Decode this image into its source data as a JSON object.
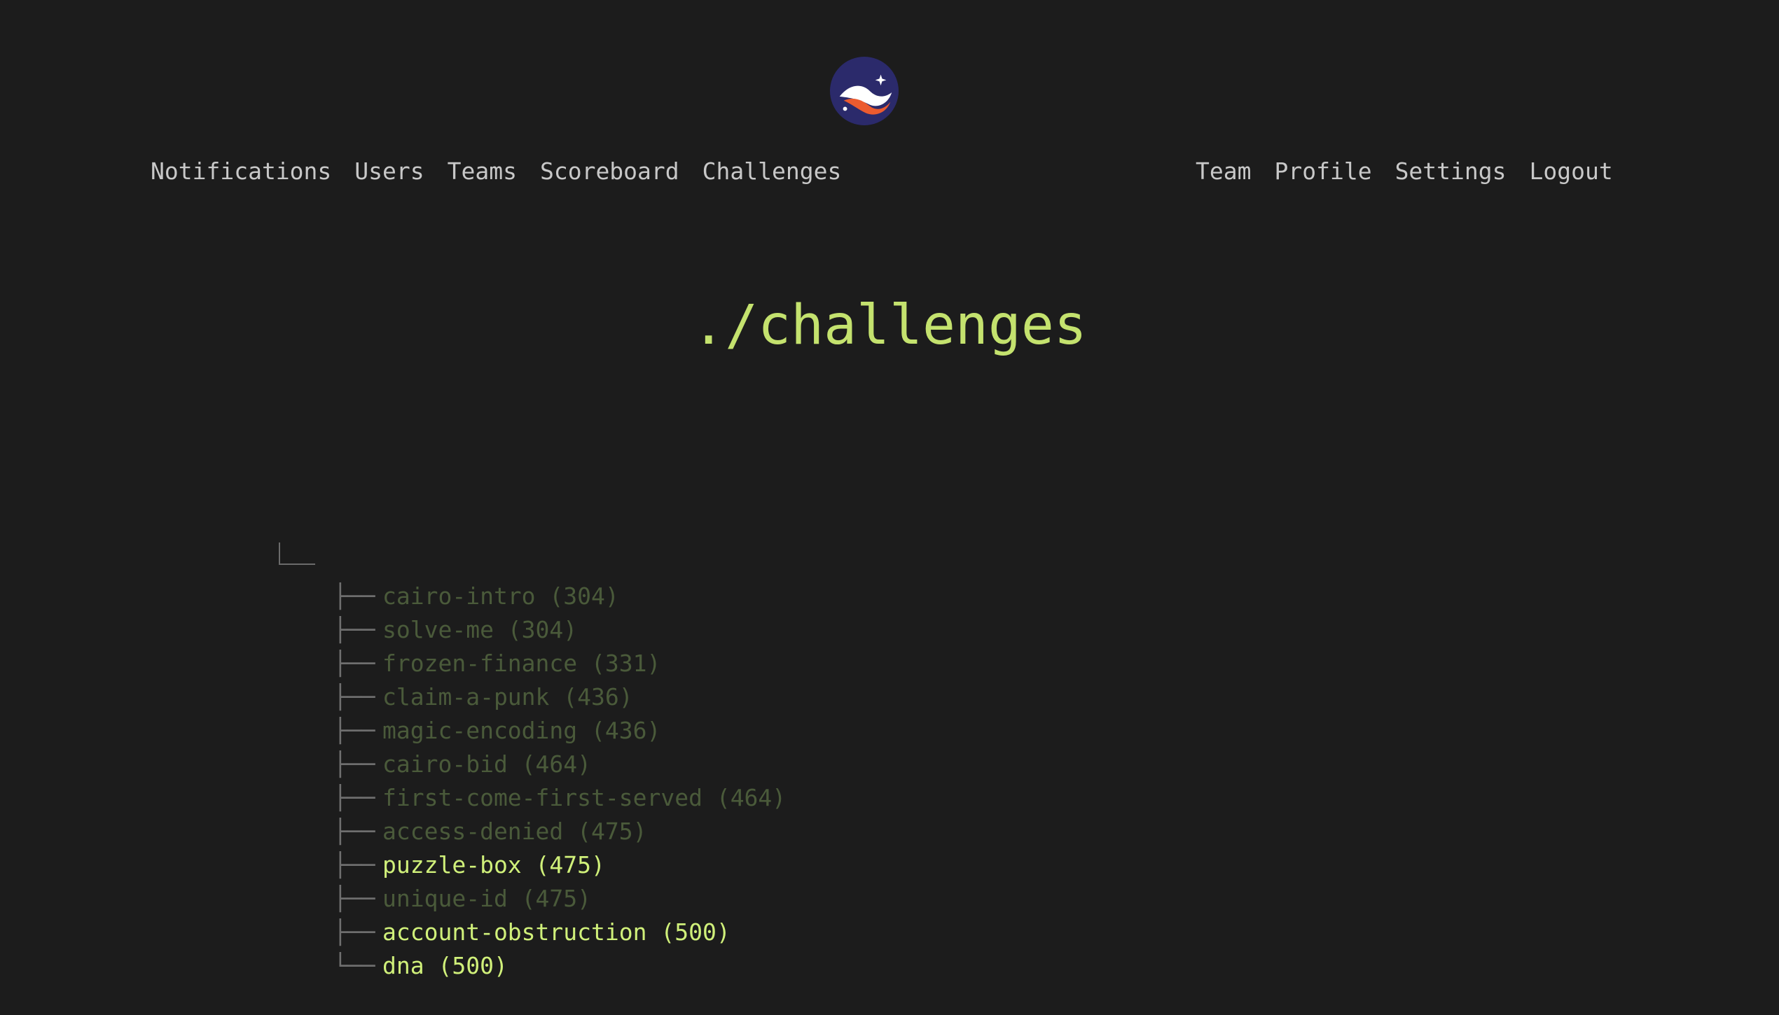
{
  "nav": {
    "left": [
      "Notifications",
      "Users",
      "Teams",
      "Scoreboard",
      "Challenges"
    ],
    "right": [
      "Team",
      "Profile",
      "Settings",
      "Logout"
    ]
  },
  "page_title": "./challenges",
  "colors": {
    "background": "#1c1c1c",
    "accent": "#c4e26e",
    "solved": "#4a5a3a",
    "unsolved": "#d0f07a",
    "logo_bg": "#2b2a6b",
    "logo_wave": "#ffffff",
    "logo_orange": "#ec5b2f"
  },
  "tree": {
    "items": [
      {
        "label": "cairo-intro (304)",
        "branch": "├──",
        "state": "solved"
      },
      {
        "label": "solve-me (304)",
        "branch": "├──",
        "state": "solved"
      },
      {
        "label": "frozen-finance (331)",
        "branch": "├──",
        "state": "solved"
      },
      {
        "label": "claim-a-punk (436)",
        "branch": "├──",
        "state": "solved"
      },
      {
        "label": "magic-encoding (436)",
        "branch": "├──",
        "state": "solved"
      },
      {
        "label": "cairo-bid (464)",
        "branch": "├──",
        "state": "solved"
      },
      {
        "label": "first-come-first-served (464)",
        "branch": "├──",
        "state": "solved"
      },
      {
        "label": "access-denied (475)",
        "branch": "├──",
        "state": "solved"
      },
      {
        "label": "puzzle-box (475)",
        "branch": "├──",
        "state": "unsolved"
      },
      {
        "label": "unique-id (475)",
        "branch": "├──",
        "state": "solved"
      },
      {
        "label": "account-obstruction (500)",
        "branch": "├──",
        "state": "unsolved"
      },
      {
        "label": "dna (500)",
        "branch": "└──",
        "state": "unsolved"
      }
    ]
  }
}
